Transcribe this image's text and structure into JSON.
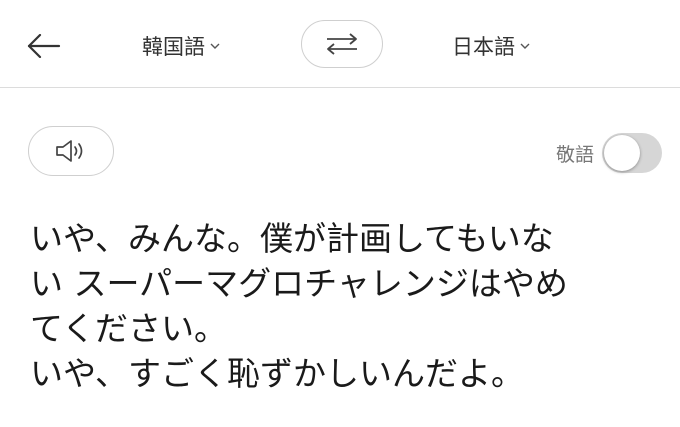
{
  "header": {
    "back_icon": "arrow-left-icon",
    "source_lang": "韓国語",
    "target_lang": "日本語",
    "swap_icon": "swap-arrows-icon",
    "chevron_icon": "chevron-down-icon"
  },
  "controls": {
    "speaker_icon": "speaker-icon",
    "honorific_label": "敬語",
    "honorific_enabled": false
  },
  "translation": {
    "lines": [
      "いや、みんな。僕が計画してもいな",
      "い スーパーマグロチャレンジはやめ",
      "てください。",
      "いや、すごく恥ずかしいんだよ。"
    ]
  },
  "colors": {
    "border": "#dcdcdc",
    "toggle_off": "#d6d6d6",
    "text": "#1a1a1a",
    "muted": "#777777"
  }
}
